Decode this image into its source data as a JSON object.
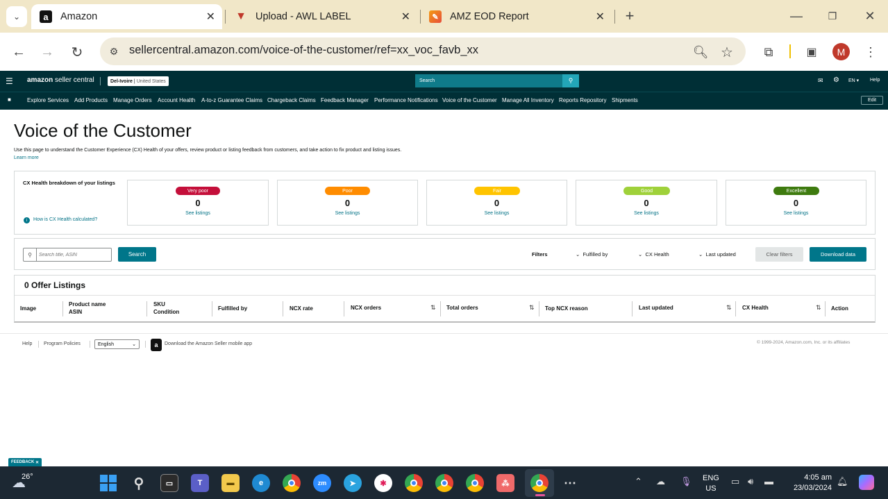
{
  "browser": {
    "tabs": [
      {
        "title": "Amazon",
        "icon": "amazon-icon"
      },
      {
        "title": "Upload - AWL LABEL",
        "icon": "awl-icon"
      },
      {
        "title": "AMZ EOD Report",
        "icon": "report-icon"
      }
    ],
    "url": "sellercentral.amazon.com/voice-of-the-customer/ref=xx_voc_favb_xx",
    "profile_initial": "M"
  },
  "header": {
    "logo_a": "amazon",
    "logo_b": "seller central",
    "store": "Del-Ivoire",
    "marketplace": "United States",
    "search_placeholder": "Search",
    "lang": "EN",
    "help": "Help"
  },
  "nav": {
    "items": [
      "Explore Services",
      "Add Products",
      "Manage Orders",
      "Account Health",
      "A-to-z Guarantee Claims",
      "Chargeback Claims",
      "Feedback Manager",
      "Performance Notifications",
      "Voice of the Customer",
      "Manage All Inventory",
      "Reports Repository",
      "Shipments"
    ],
    "edit": "Edit"
  },
  "page": {
    "title": "Voice of the Customer",
    "description": "Use this page to understand the Customer Experience (CX) Health of your offers, review product or listing feedback from customers, and take action to fix product and listing issues.",
    "learn_more": "Learn more",
    "breakdown_title": "CX Health breakdown of your listings",
    "calc_link": "How is CX Health calculated?",
    "health_cards": [
      {
        "label": "Very poor",
        "count": "0",
        "link": "See listings",
        "color": "#c40f3a"
      },
      {
        "label": "Poor",
        "count": "0",
        "link": "See listings",
        "color": "#ff8c00"
      },
      {
        "label": "Fair",
        "count": "0",
        "link": "See listings",
        "color": "#ffc400"
      },
      {
        "label": "Good",
        "count": "0",
        "link": "See listings",
        "color": "#9fd13a"
      },
      {
        "label": "Excellent",
        "count": "0",
        "link": "See listings",
        "color": "#3e7b0f"
      }
    ],
    "search_placeholder": "Search title, ASIN",
    "search_button": "Search",
    "filters_label": "Filters",
    "filter_fulfilled": "Fulfilled by",
    "filter_cx": "CX Health",
    "filter_updated": "Last updated",
    "clear_filters": "Clear filters",
    "download": "Download data",
    "listings_title": "0 Offer Listings",
    "columns": {
      "image": "Image",
      "product_name": "Product name",
      "asin": "ASIN",
      "sku": "SKU",
      "condition": "Condition",
      "fulfilled_by": "Fulfilled by",
      "ncx_rate": "NCX rate",
      "ncx_orders": "NCX orders",
      "total_orders": "Total orders",
      "top_reason": "Top NCX reason",
      "last_updated": "Last updated",
      "cx_health": "CX Health",
      "action": "Action"
    }
  },
  "footer": {
    "help": "Help",
    "policies": "Program Policies",
    "language": "English",
    "app": "Download the Amazon Seller mobile app",
    "copyright": "© 1999-2024, Amazon.com, Inc. or its affiliates",
    "feedback": "FEEDBACK"
  },
  "taskbar": {
    "temp": "26°",
    "lang1": "ENG",
    "lang2": "US",
    "time": "4:05 am",
    "date": "23/03/2024"
  }
}
